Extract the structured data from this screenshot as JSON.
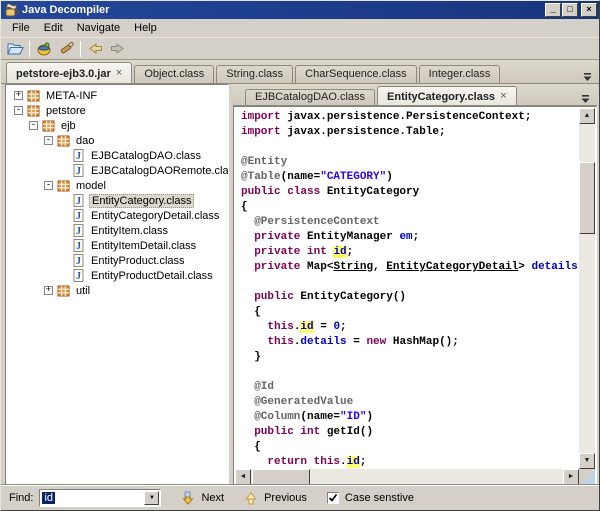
{
  "window": {
    "title": "Java Decompiler"
  },
  "window_controls": [
    {
      "name": "minimize-button",
      "glyph": "_"
    },
    {
      "name": "maximize-button",
      "glyph": "□"
    },
    {
      "name": "close-button",
      "glyph": "×"
    }
  ],
  "menu": [
    "File",
    "Edit",
    "Navigate",
    "Help"
  ],
  "toolbar": [
    {
      "icon": "open-file-icon",
      "sep_after": true
    },
    {
      "icon": "open-type-icon"
    },
    {
      "icon": "search-icon",
      "sep_after": true
    },
    {
      "icon": "back-icon"
    },
    {
      "icon": "forward-icon"
    }
  ],
  "file_tabs": [
    {
      "label": "petstore-ejb3.0.jar",
      "active": true,
      "closable": true
    },
    {
      "label": "Object.class"
    },
    {
      "label": "String.class"
    },
    {
      "label": "CharSequence.class"
    },
    {
      "label": "Integer.class"
    }
  ],
  "tree": [
    {
      "label": "META-INF",
      "icon": "package",
      "handle": "+",
      "depth": 0
    },
    {
      "label": "petstore",
      "icon": "package",
      "handle": "-",
      "depth": 0
    },
    {
      "label": "ejb",
      "icon": "package",
      "handle": "-",
      "depth": 1
    },
    {
      "label": "dao",
      "icon": "package",
      "handle": "-",
      "depth": 2
    },
    {
      "label": "EJBCatalogDAO.class",
      "icon": "class",
      "depth": 3
    },
    {
      "label": "EJBCatalogDAORemote.class",
      "icon": "class",
      "depth": 3
    },
    {
      "label": "model",
      "icon": "package",
      "handle": "-",
      "depth": 2
    },
    {
      "label": "EntityCategory.class",
      "icon": "class",
      "depth": 3,
      "selected": true
    },
    {
      "label": "EntityCategoryDetail.class",
      "icon": "class",
      "depth": 3
    },
    {
      "label": "EntityItem.class",
      "icon": "class",
      "depth": 3
    },
    {
      "label": "EntityItemDetail.class",
      "icon": "class",
      "depth": 3
    },
    {
      "label": "EntityProduct.class",
      "icon": "class",
      "depth": 3
    },
    {
      "label": "EntityProductDetail.class",
      "icon": "class",
      "depth": 3
    },
    {
      "label": "util",
      "icon": "package",
      "handle": "+",
      "depth": 2
    }
  ],
  "code_tabs": [
    {
      "label": "EJBCatalogDAO.class"
    },
    {
      "label": "EntityCategory.class",
      "active": true,
      "closable": true
    }
  ],
  "code": {
    "lines": [
      [
        {
          "t": "import",
          "c": "k"
        },
        {
          "t": " javax.persistence.PersistenceContext;",
          "c": "p"
        }
      ],
      [
        {
          "t": "import",
          "c": "k"
        },
        {
          "t": " javax.persistence.Table;",
          "c": "p"
        }
      ],
      [],
      [
        {
          "t": "@Entity",
          "c": "a"
        }
      ],
      [
        {
          "t": "@Table",
          "c": "a"
        },
        {
          "t": "(name=",
          "c": "p"
        },
        {
          "t": "\"CATEGORY\"",
          "c": "s"
        },
        {
          "t": ")",
          "c": "p"
        }
      ],
      [
        {
          "t": "public class",
          "c": "k"
        },
        {
          "t": " EntityCategory",
          "c": "p"
        }
      ],
      [
        {
          "t": "{",
          "c": "p"
        }
      ],
      [
        {
          "t": "  ",
          "c": "p"
        },
        {
          "t": "@PersistenceContext",
          "c": "a"
        }
      ],
      [
        {
          "t": "  ",
          "c": "p"
        },
        {
          "t": "private",
          "c": "k"
        },
        {
          "t": " EntityManager ",
          "c": "p"
        },
        {
          "t": "em",
          "c": "f"
        },
        {
          "t": ";",
          "c": "p"
        }
      ],
      [
        {
          "t": "  ",
          "c": "p"
        },
        {
          "t": "private",
          "c": "k"
        },
        {
          "t": " ",
          "c": "p"
        },
        {
          "t": "int",
          "c": "k"
        },
        {
          "t": " ",
          "c": "p"
        },
        {
          "t": "id",
          "c": "f",
          "h": true
        },
        {
          "t": ";",
          "c": "p"
        }
      ],
      [
        {
          "t": "  ",
          "c": "p"
        },
        {
          "t": "private",
          "c": "k"
        },
        {
          "t": " Map<",
          "c": "p"
        },
        {
          "t": "String",
          "c": "u"
        },
        {
          "t": ", ",
          "c": "p"
        },
        {
          "t": "EntityCategoryDetail",
          "c": "u"
        },
        {
          "t": "> ",
          "c": "p"
        },
        {
          "t": "details",
          "c": "f"
        },
        {
          "t": ";",
          "c": "p"
        }
      ],
      [],
      [
        {
          "t": "  ",
          "c": "p"
        },
        {
          "t": "public",
          "c": "k"
        },
        {
          "t": " EntityCategory()",
          "c": "p"
        }
      ],
      [
        {
          "t": "  {",
          "c": "p"
        }
      ],
      [
        {
          "t": "    ",
          "c": "p"
        },
        {
          "t": "this",
          "c": "k"
        },
        {
          "t": ".",
          "c": "p"
        },
        {
          "t": "id",
          "c": "f",
          "h": true
        },
        {
          "t": " = ",
          "c": "p"
        },
        {
          "t": "0",
          "c": "n"
        },
        {
          "t": ";",
          "c": "p"
        }
      ],
      [
        {
          "t": "    ",
          "c": "p"
        },
        {
          "t": "this",
          "c": "k"
        },
        {
          "t": ".",
          "c": "p"
        },
        {
          "t": "details",
          "c": "f"
        },
        {
          "t": " = ",
          "c": "p"
        },
        {
          "t": "new",
          "c": "k"
        },
        {
          "t": " HashMap();",
          "c": "p"
        }
      ],
      [
        {
          "t": "  }",
          "c": "p"
        }
      ],
      [],
      [
        {
          "t": "  ",
          "c": "p"
        },
        {
          "t": "@Id",
          "c": "a"
        }
      ],
      [
        {
          "t": "  ",
          "c": "p"
        },
        {
          "t": "@GeneratedValue",
          "c": "a"
        }
      ],
      [
        {
          "t": "  ",
          "c": "p"
        },
        {
          "t": "@Column",
          "c": "a"
        },
        {
          "t": "(name=",
          "c": "p"
        },
        {
          "t": "\"ID\"",
          "c": "s"
        },
        {
          "t": ")",
          "c": "p"
        }
      ],
      [
        {
          "t": "  ",
          "c": "p"
        },
        {
          "t": "public",
          "c": "k"
        },
        {
          "t": " ",
          "c": "p"
        },
        {
          "t": "int",
          "c": "k"
        },
        {
          "t": " getId()",
          "c": "p"
        }
      ],
      [
        {
          "t": "  {",
          "c": "p"
        }
      ],
      [
        {
          "t": "    ",
          "c": "p"
        },
        {
          "t": "return",
          "c": "k"
        },
        {
          "t": " ",
          "c": "p"
        },
        {
          "t": "this",
          "c": "k"
        },
        {
          "t": ".",
          "c": "p"
        },
        {
          "t": "id",
          "c": "f",
          "h": true
        },
        {
          "t": ";",
          "c": "p"
        }
      ]
    ]
  },
  "find": {
    "label": "Find:",
    "value": "id",
    "next_label": "Next",
    "previous_label": "Previous",
    "case_label": "Case senstive",
    "case_checked": true
  },
  "colors": {
    "titlebar_blue": "#16357f",
    "chrome_gray": "#d4d0c8",
    "keyword": "#7f0055",
    "annotation": "#646464",
    "string": "#2a00ff",
    "field": "#0000c0",
    "search_highlight": "#ffff69",
    "package_orange": "#e8963c"
  }
}
